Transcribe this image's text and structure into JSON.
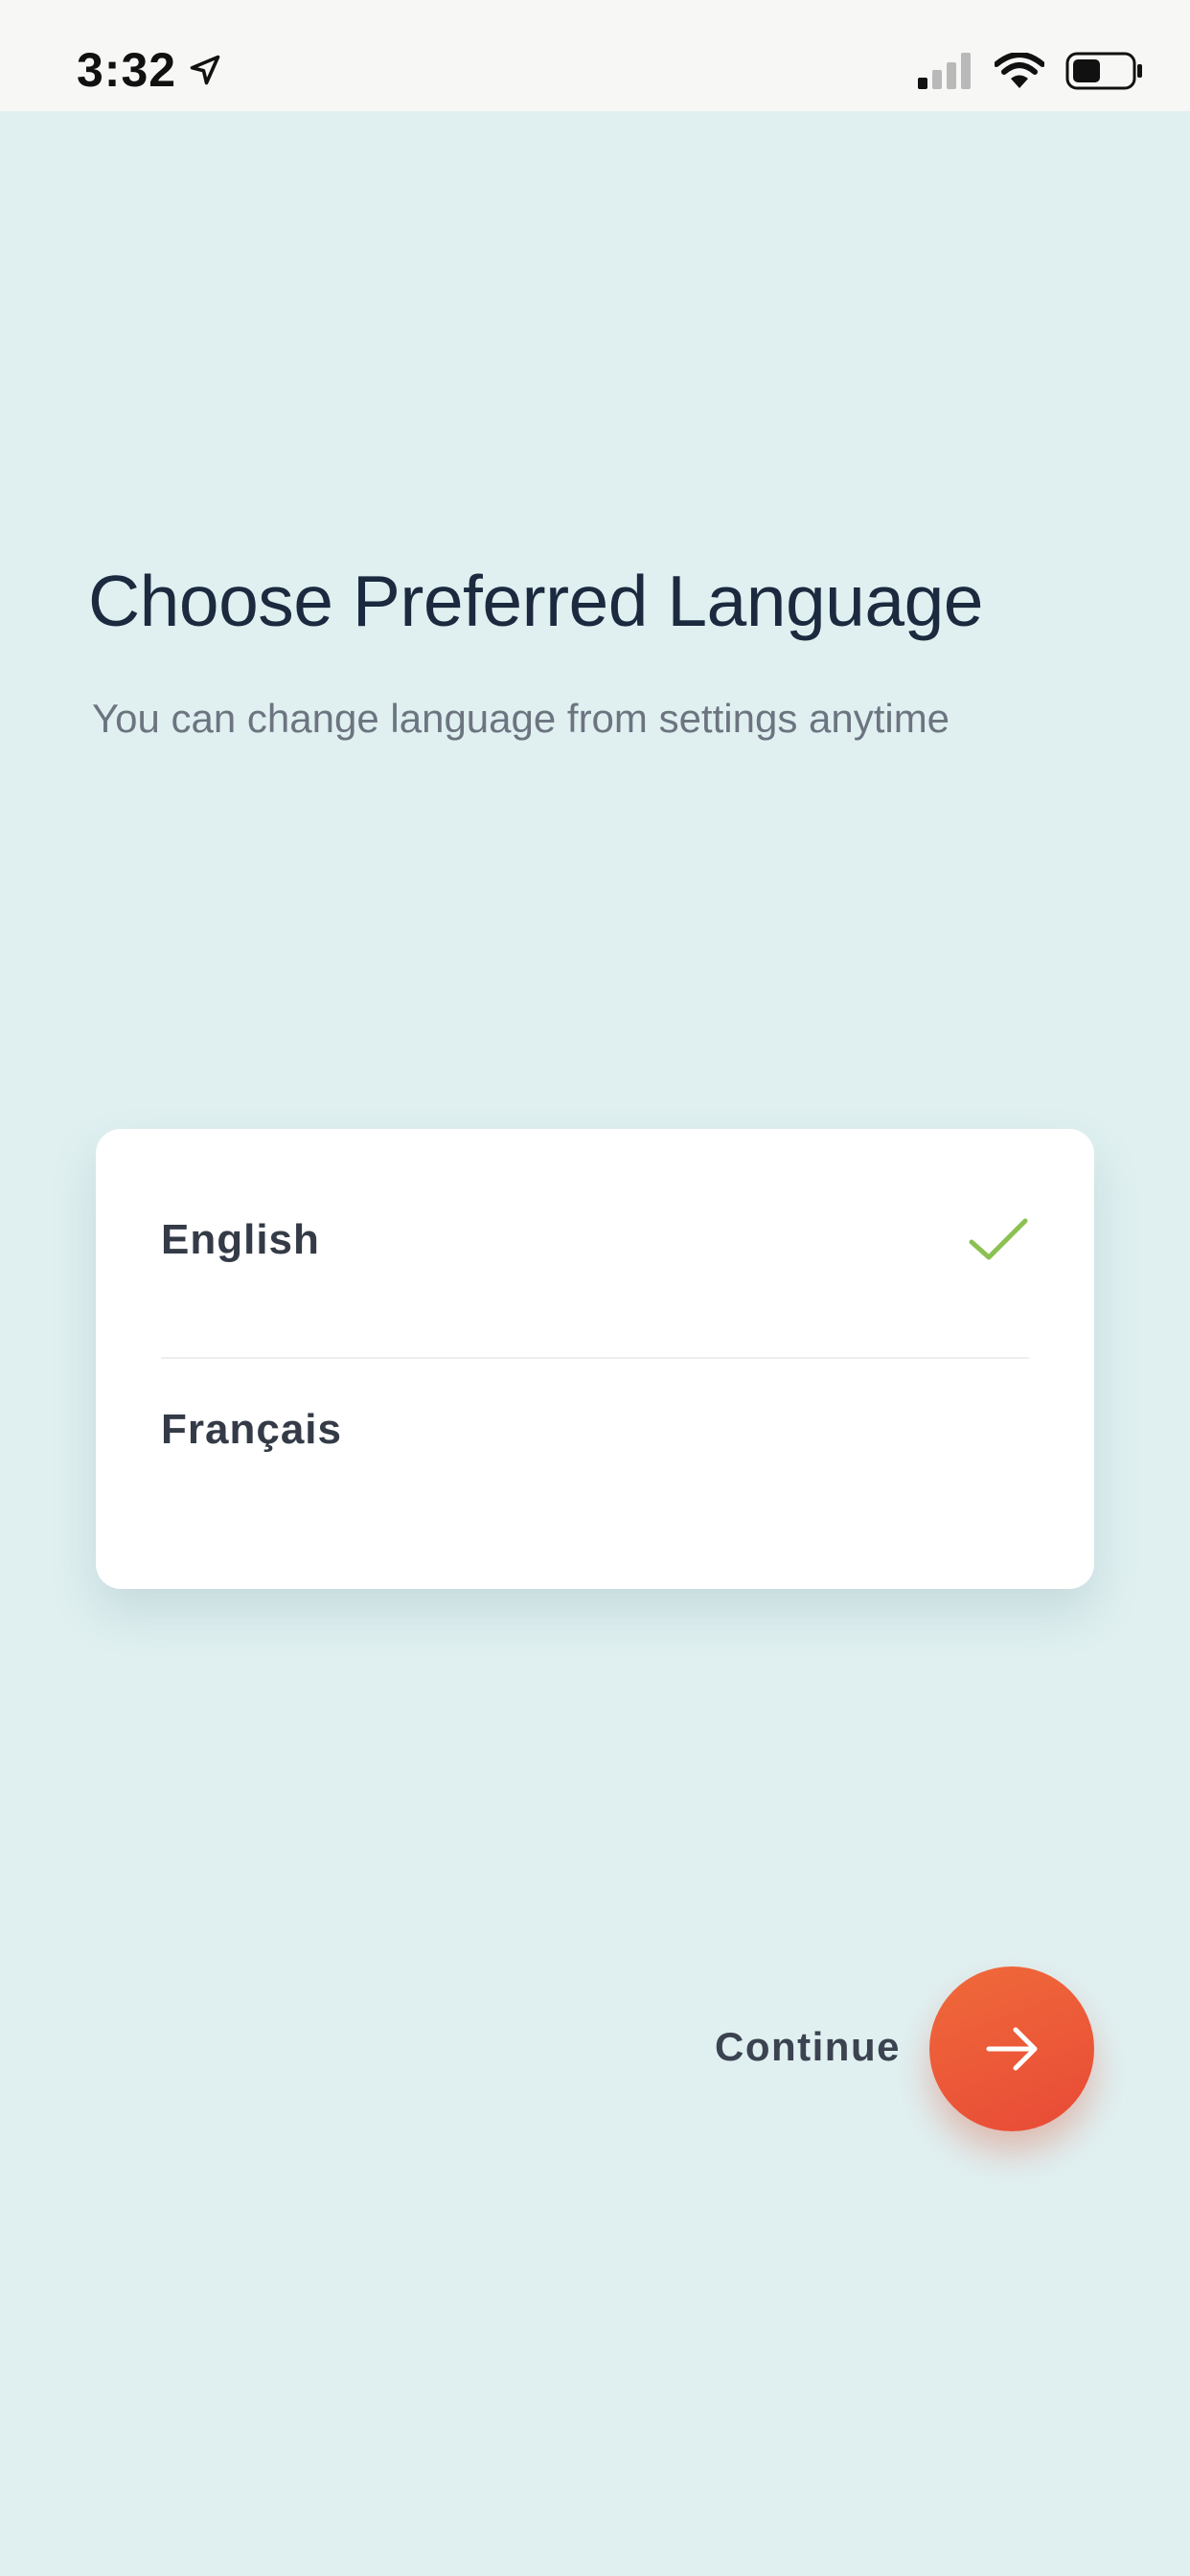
{
  "status_bar": {
    "time": "3:32",
    "location_icon": "location-arrow-icon",
    "signal_icon": "cellular-signal-icon",
    "wifi_icon": "wifi-icon",
    "battery_icon": "battery-icon"
  },
  "header": {
    "title": "Choose Preferred Language",
    "subtitle": "You can change language from settings anytime"
  },
  "languages": {
    "items": [
      {
        "label": "English",
        "selected": true
      },
      {
        "label": "Français",
        "selected": false
      }
    ],
    "check_icon": "checkmark-icon",
    "check_color": "#8cc152"
  },
  "footer": {
    "continue_label": "Continue",
    "continue_icon": "arrow-right-icon",
    "accent_color": "#e84a36"
  }
}
